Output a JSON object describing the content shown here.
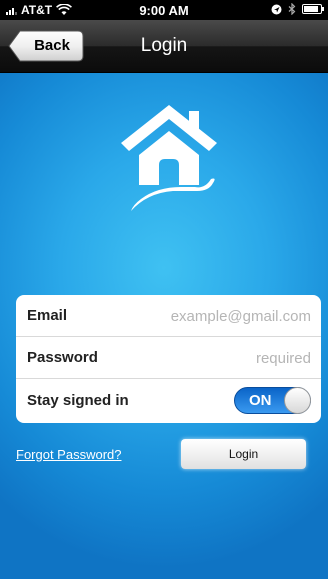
{
  "status_bar": {
    "carrier": "AT&T",
    "time": "9:00 AM",
    "icons": [
      "signal-icon",
      "wifi-icon",
      "location-icon",
      "bluetooth-icon",
      "battery-icon"
    ]
  },
  "nav_bar": {
    "back_label": "Back",
    "title": "Login"
  },
  "logo": {
    "icon": "house-hand-icon",
    "color": "#ffffff"
  },
  "form": {
    "email": {
      "label": "Email",
      "placeholder": "example@gmail.com",
      "value": ""
    },
    "password": {
      "label": "Password",
      "placeholder": "required",
      "value": ""
    },
    "stay_signed_in": {
      "label": "Stay signed in",
      "toggle_label": "ON",
      "state": true
    }
  },
  "actions": {
    "forgot_password": "Forgot Password?",
    "login_label": "Login"
  },
  "colors": {
    "background": "#1b8fd9",
    "toggle_on": "#1a7ee0",
    "nav_bar": "#1a1a1a"
  }
}
